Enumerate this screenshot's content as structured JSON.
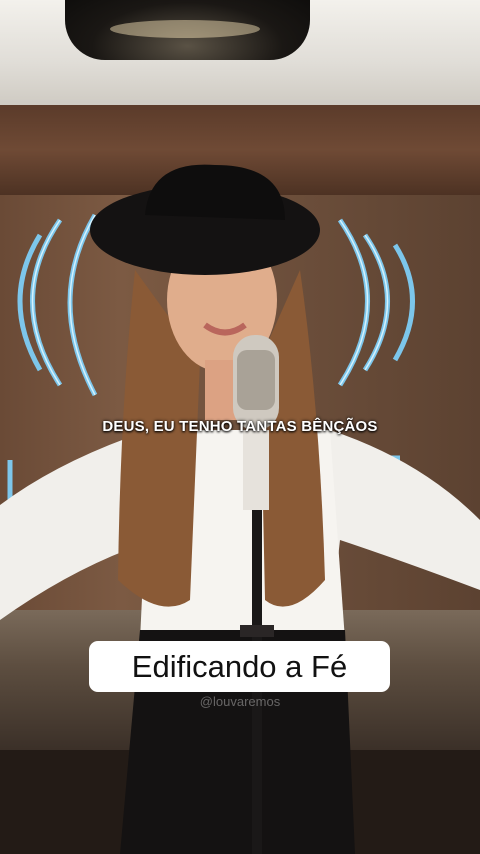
{
  "video": {
    "lyric_caption": "DEUS, EU TENHO TANTAS BÊNÇÃOS",
    "channel_badge": "Edificando a Fé",
    "watermark": "@louvaremos"
  },
  "icons": [
    "pendant-lamp-icon",
    "neon-sign-icon",
    "microphone-icon"
  ],
  "colors": {
    "neon": "#7fd4ff",
    "badge_bg": "#ffffff",
    "caption_text": "#ffffff"
  }
}
